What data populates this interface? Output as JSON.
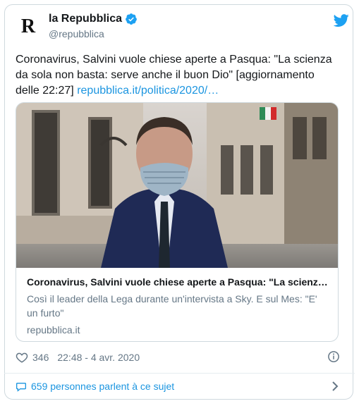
{
  "account": {
    "avatar_letter": "R",
    "display_name": "la Repubblica",
    "handle": "@repubblica",
    "verified": true
  },
  "icons": {
    "verified": "verified-badge-icon",
    "platform": "twitter-bird-icon",
    "like": "heart-icon",
    "info": "info-icon",
    "conversation": "speech-bubble-icon",
    "more": "chevron-right-icon"
  },
  "tweet": {
    "text": "Coronavirus, Salvini vuole chiese aperte a Pasqua: \"La scienza da sola non basta: serve anche il buon Dio\" [aggiornamento delle 22:27] ",
    "link": "repubblica.it/politica/2020/…"
  },
  "preview": {
    "title": "Coronavirus, Salvini vuole chiese aperte a Pasqua: \"La scienz…",
    "description": "Così il leader della Lega durante un'intervista a Sky. E sul Mes: \"E' un furto\"",
    "domain": "repubblica.it"
  },
  "meta": {
    "likes": "346",
    "timestamp": "22:48 - 4 avr. 2020"
  },
  "footer": {
    "conversation": "659 personnes parlent à ce sujet"
  },
  "colors": {
    "link": "#1b95e0",
    "secondary_text": "#657786",
    "border": "#cfd9de"
  }
}
